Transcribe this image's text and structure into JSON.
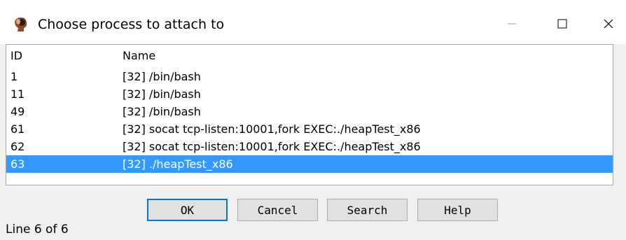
{
  "window": {
    "title": "Choose process to attach to"
  },
  "list": {
    "columns": {
      "id": "ID",
      "name": "Name"
    },
    "rows": [
      {
        "id": "1",
        "name": "[32] /bin/bash"
      },
      {
        "id": "11",
        "name": "[32] /bin/bash"
      },
      {
        "id": "49",
        "name": "[32] /bin/bash"
      },
      {
        "id": "61",
        "name": "[32] socat tcp-listen:10001,fork EXEC:./heapTest_x86"
      },
      {
        "id": "62",
        "name": "[32] socat tcp-listen:10001,fork EXEC:./heapTest_x86"
      },
      {
        "id": "63",
        "name": "[32] ./heapTest_x86"
      }
    ],
    "selected_index": 5,
    "selection_color": "#3399ff"
  },
  "buttons": {
    "ok": "OK",
    "cancel": "Cancel",
    "search": "Search",
    "help": "Help"
  },
  "status": "Line 6 of 6",
  "icons": {
    "app": "ghidra-head-icon",
    "minimize": "minimize-icon",
    "maximize": "maximize-icon",
    "close": "close-icon"
  }
}
